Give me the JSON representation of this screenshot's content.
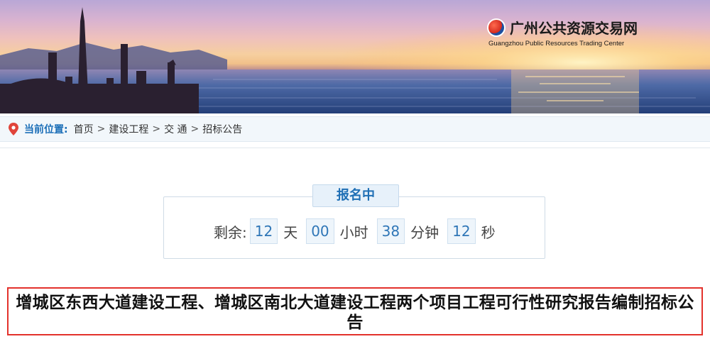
{
  "banner": {
    "logo_cn": "广州公共资源交易网",
    "logo_en": "Guangzhou Public Resources Trading Center"
  },
  "breadcrumb": {
    "label": "当前位置:",
    "items": [
      "首页",
      "建设工程",
      "交 通",
      "招标公告"
    ],
    "separator": ">"
  },
  "status": {
    "tag": "报名中",
    "remaining_label": "剩余:",
    "days": "12",
    "days_unit": "天",
    "hours": "00",
    "hours_unit": "小时",
    "minutes": "38",
    "minutes_unit": "分钟",
    "seconds": "12",
    "seconds_unit": "秒"
  },
  "announcement": {
    "title": "增城区东西大道建设工程、增城区南北大道建设工程两个项目工程可行性研究报告编制招标公告"
  },
  "colors": {
    "accent_blue": "#1f6fb5",
    "highlight_red": "#e3322c",
    "pin_red": "#e0443a"
  }
}
